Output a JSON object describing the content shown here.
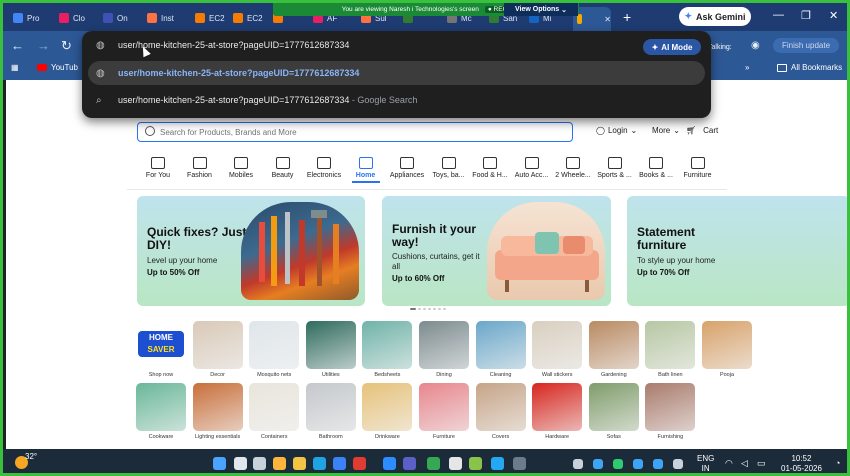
{
  "browser": {
    "tabs": [
      {
        "label": "Pro",
        "color": "#4285f4"
      },
      {
        "label": "Clo",
        "color": "#e91e63"
      },
      {
        "label": "On",
        "color": "#3f51b5"
      },
      {
        "label": "Inst",
        "color": "#ff7043"
      },
      {
        "label": "EC2",
        "color": "#f57c00"
      },
      {
        "label": "EC2",
        "color": "#f57c00"
      },
      {
        "label": "",
        "color": "#f57c00"
      },
      {
        "label": "AF",
        "color": "#e91e63"
      },
      {
        "label": "Sul",
        "color": "#ff7043"
      },
      {
        "label": "",
        "color": "#2e7d32"
      },
      {
        "label": "Mc",
        "color": "#757575"
      },
      {
        "label": "San",
        "color": "#2e7d32"
      },
      {
        "label": "Mi",
        "color": "#1565c0"
      },
      {
        "label": "",
        "color": "#f2a900"
      }
    ],
    "new_tab": "+",
    "ask_gemini": "Ask Gemini",
    "screen_share_banner": "You are viewing  Naresh i Technologies's screen",
    "rec_label": "REC",
    "view_options": "View Options",
    "talking_label": "Talking:",
    "finish_update": "Finish update",
    "bookmarks": {
      "youtube": "YouTub",
      "all_bookmarks": "All Bookmarks"
    }
  },
  "omnibox": {
    "typed_text": "user/home-kitchen-25-at-store?pageUID=1777612687334",
    "ai_mode": "AI Mode",
    "suggestion_1": "user/home-kitchen-25-at-store?pageUID=1777612687334",
    "suggestion_2": "user/home-kitchen-25-at-store?pageUID=1777612687334",
    "suggestion_2_suffix": " - Google Search"
  },
  "store": {
    "search_placeholder": "Search for Products, Brands and More",
    "login": "Login",
    "more": "More",
    "cart": "Cart",
    "categories": [
      "For You",
      "Fashion",
      "Mobiles",
      "Beauty",
      "Electronics",
      "Home",
      "Appliances",
      "Toys, ba...",
      "Food & H...",
      "Auto Acc...",
      "2 Wheele...",
      "Sports & ...",
      "Books & ...",
      "Furniture"
    ],
    "active_category": "Home",
    "banners": [
      {
        "title": "Quick fixes? Just DIY!",
        "subtitle": "Level up your home",
        "offer": "Up to 50% Off"
      },
      {
        "title": "Furnish it your way!",
        "subtitle": "Cushions, curtains, get it all",
        "offer": "Up to 60% Off"
      },
      {
        "title": "Statement furniture",
        "subtitle": "To style up your home",
        "offer": "Up to 70% Off"
      }
    ],
    "tiles_row1": [
      "Shop now",
      "Decor",
      "Mosquito nets",
      "Utilities",
      "Bedsheets",
      "Dining",
      "Cleaning",
      "Wall stickers",
      "Gardening",
      "Bath linen",
      "Pooja"
    ],
    "tiles_row2": [
      "Cookware",
      "Lighting essentials",
      "Containers",
      "Bathroom",
      "Drinkware",
      "Furniture",
      "Covers",
      "Hardware",
      "Sofas",
      "Furnishing"
    ],
    "home_saver_badge": [
      "HOME",
      "SAVER"
    ]
  },
  "taskbar": {
    "temperature": "32°",
    "lang": "ENG",
    "region": "IN",
    "time": "10:52",
    "date": "01-05-2026"
  }
}
